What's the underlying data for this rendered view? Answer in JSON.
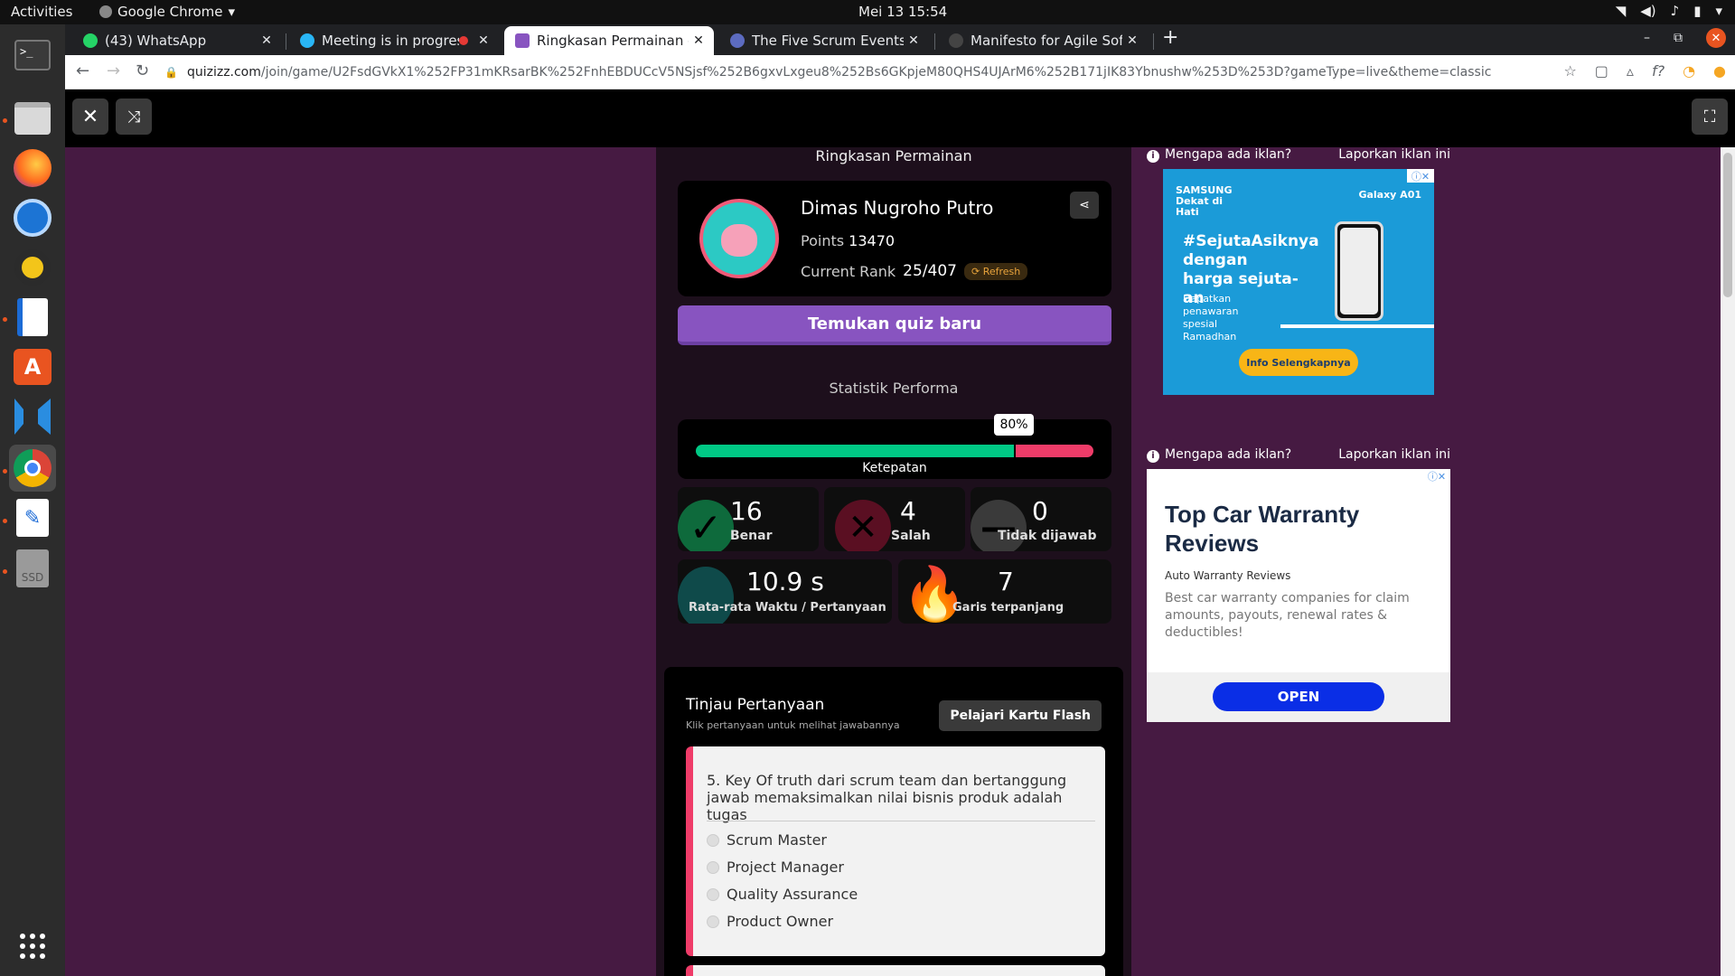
{
  "system": {
    "activities": "Activities",
    "app_name": "Google Chrome",
    "clock": "Mei 13  15:54"
  },
  "dock": {
    "items": [
      "terminal-icon",
      "files-icon",
      "firefox-icon",
      "thunderbird-icon",
      "rhythmbox-icon",
      "writer-icon",
      "software-icon",
      "vscode-icon",
      "chrome-icon",
      "text-editor-icon",
      "ssd-drive-icon",
      "show-apps-icon"
    ],
    "ssd_label": "SSD"
  },
  "tabs": [
    {
      "title": "(43) WhatsApp",
      "color": "#25d366"
    },
    {
      "title": "Meeting is in progress",
      "color": "#29b6f6"
    },
    {
      "title": "Ringkasan Permainan - Quizizz",
      "color": "#8854c0"
    },
    {
      "title": "The Five Scrum Events - Th",
      "color": "#5c6bc0"
    },
    {
      "title": "Manifesto for Agile Softw",
      "color": "#444444"
    }
  ],
  "address": {
    "host": "quizizz.com",
    "path": "/join/game/U2FsdGVkX1%252FP31mKRsarBK%252FnhEBDUCcV5NSjsf%252B6gxvLxgeu8%252Bs6GKpjeM80QHS4UJArM6%252B171jIK83Ybnushw%253D%253D?gameType=live&theme=classic"
  },
  "summary": {
    "title": "Ringkasan Permainan",
    "player_name": "Dimas Nugroho Putro",
    "points_label": "Points",
    "points": "13470",
    "rank_label": "Current Rank",
    "rank": "25/407",
    "refresh_label": "Refresh",
    "find_quiz": "Temukan quiz baru"
  },
  "stats": {
    "title": "Statistik Performa",
    "accuracy_percent": 80,
    "accuracy_badge": "80%",
    "accuracy_label": "Ketepatan",
    "correct": "16",
    "correct_label": "Benar",
    "wrong": "4",
    "wrong_label": "Salah",
    "unanswered": "0",
    "unanswered_label": "Tidak dijawab",
    "avg_time": "10.9 s",
    "avg_time_label": "Rata-rata Waktu / Pertanyaan",
    "streak": "7",
    "streak_label": "Garis terpanjang",
    "colors": {
      "correct": "#00c985",
      "wrong": "#ef3c69"
    }
  },
  "review": {
    "title": "Tinjau Pertanyaan",
    "subtitle": "Klik pertanyaan untuk melihat jawabannya",
    "flashcard_button": "Pelajari Kartu Flash",
    "question": "5.   Key Of truth dari scrum team dan bertanggung jawab memaksimalkan nilai bisnis produk adalah tugas",
    "options": [
      "Scrum Master",
      "Project Manager",
      "Quality Assurance",
      "Product Owner"
    ]
  },
  "ads": {
    "why_label": "Mengapa ada iklan?",
    "report_label": "Laporkan iklan ini",
    "ad1": {
      "brand": "SAMSUNG Dekat di Hati",
      "model": "Galaxy A01",
      "headline": "#SejutaAsiknya dengan harga sejuta-an",
      "text": "Dapatkan penawaran spesial Ramadhan",
      "cta": "Info Selengkapnya"
    },
    "ad2": {
      "headline": "Top Car Warranty Reviews",
      "source": "Auto Warranty Reviews",
      "description": "Best car warranty companies for claim amounts, payouts, renewal rates & deductibles!",
      "cta": "OPEN"
    }
  }
}
